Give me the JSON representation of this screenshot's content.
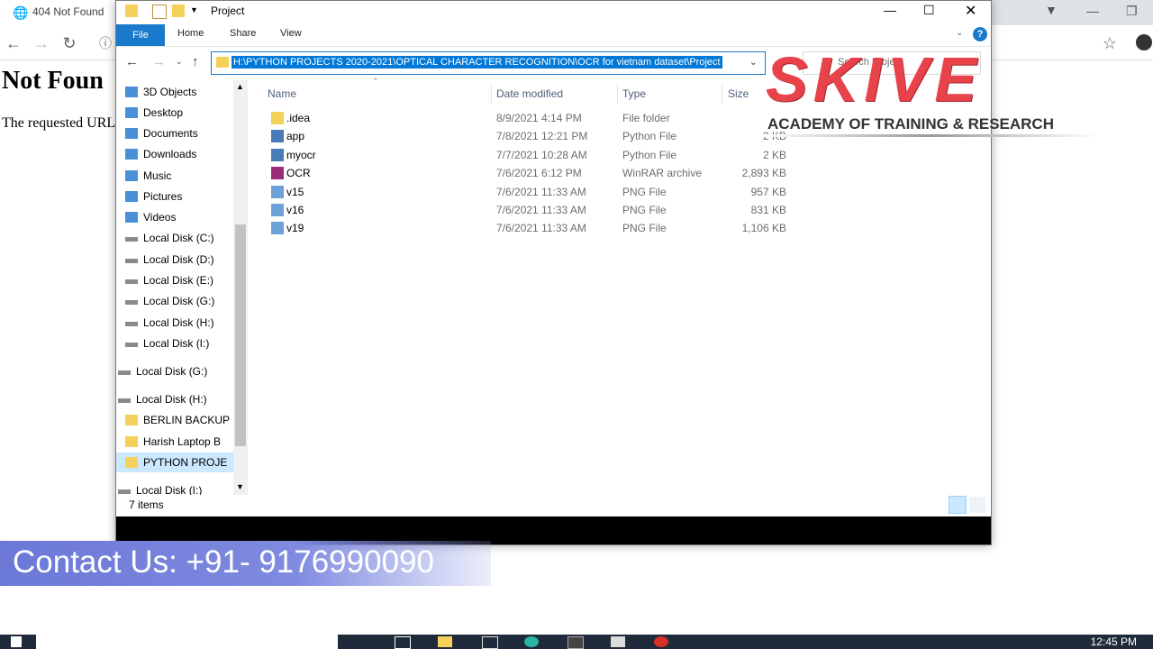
{
  "browser": {
    "tab_title": "404 Not Found",
    "page_heading": "Not Foun",
    "page_text": "The requested URL"
  },
  "explorer": {
    "title": "Project",
    "ribbon": {
      "file": "File",
      "home": "Home",
      "share": "Share",
      "view": "View",
      "help": "?"
    },
    "address": "H:\\PYTHON PROJECTS 2020-2021\\OPTICAL CHARACTER RECOGNITION\\OCR for vietnam dataset\\Project",
    "search_placeholder": "Search Project",
    "nav_items": [
      {
        "label": "3D Objects",
        "icon": "3d-objects-icon"
      },
      {
        "label": "Desktop",
        "icon": "desktop-icon"
      },
      {
        "label": "Documents",
        "icon": "documents-icon"
      },
      {
        "label": "Downloads",
        "icon": "downloads-icon"
      },
      {
        "label": "Music",
        "icon": "music-icon"
      },
      {
        "label": "Pictures",
        "icon": "pictures-icon"
      },
      {
        "label": "Videos",
        "icon": "videos-icon"
      },
      {
        "label": "Local Disk (C:)",
        "icon": "drive-icon"
      },
      {
        "label": "Local Disk (D:)",
        "icon": "drive-icon"
      },
      {
        "label": "Local Disk (E:)",
        "icon": "drive-icon"
      },
      {
        "label": "Local Disk (G:)",
        "icon": "drive-icon"
      },
      {
        "label": "Local Disk (H:)",
        "icon": "drive-icon"
      },
      {
        "label": "Local Disk (I:)",
        "icon": "drive-icon"
      },
      {
        "label": "Local Disk (G:)",
        "icon": "drive-icon"
      },
      {
        "label": "Local Disk (H:)",
        "icon": "drive-icon"
      },
      {
        "label": "BERLIN BACKUP",
        "icon": "folder-icon"
      },
      {
        "label": "Harish Laptop B",
        "icon": "folder-icon"
      },
      {
        "label": "PYTHON PROJE",
        "icon": "folder-icon"
      },
      {
        "label": "Local Disk (I:)",
        "icon": "drive-icon"
      }
    ],
    "columns": {
      "name": "Name",
      "date": "Date modified",
      "type": "Type",
      "size": "Size"
    },
    "files": [
      {
        "name": ".idea",
        "date": "8/9/2021 4:14 PM",
        "type": "File folder",
        "size": "",
        "icon": "folder-icon"
      },
      {
        "name": "app",
        "date": "7/8/2021 12:21 PM",
        "type": "Python File",
        "size": "2 KB",
        "icon": "python-file-icon"
      },
      {
        "name": "myocr",
        "date": "7/7/2021 10:28 AM",
        "type": "Python File",
        "size": "2 KB",
        "icon": "python-file-icon"
      },
      {
        "name": "OCR",
        "date": "7/6/2021 6:12 PM",
        "type": "WinRAR archive",
        "size": "2,893 KB",
        "icon": "winrar-icon"
      },
      {
        "name": "v15",
        "date": "7/6/2021 11:33 AM",
        "type": "PNG File",
        "size": "957 KB",
        "icon": "png-file-icon"
      },
      {
        "name": "v16",
        "date": "7/6/2021 11:33 AM",
        "type": "PNG File",
        "size": "831 KB",
        "icon": "png-file-icon"
      },
      {
        "name": "v19",
        "date": "7/6/2021 11:33 AM",
        "type": "PNG File",
        "size": "1,106 KB",
        "icon": "png-file-icon"
      }
    ],
    "status": "7 items"
  },
  "logo": {
    "brand": "SKIVE",
    "tagline": "ACADEMY OF TRAINING & RESEARCH"
  },
  "contact": {
    "text": "Contact Us: +91- 9176990090"
  },
  "taskbar": {
    "clock": "12:45 PM"
  },
  "colors": {
    "accent": "#1979ca",
    "selection": "#0078d7",
    "brand_red": "#e8424a",
    "banner": "#6b78d6"
  }
}
